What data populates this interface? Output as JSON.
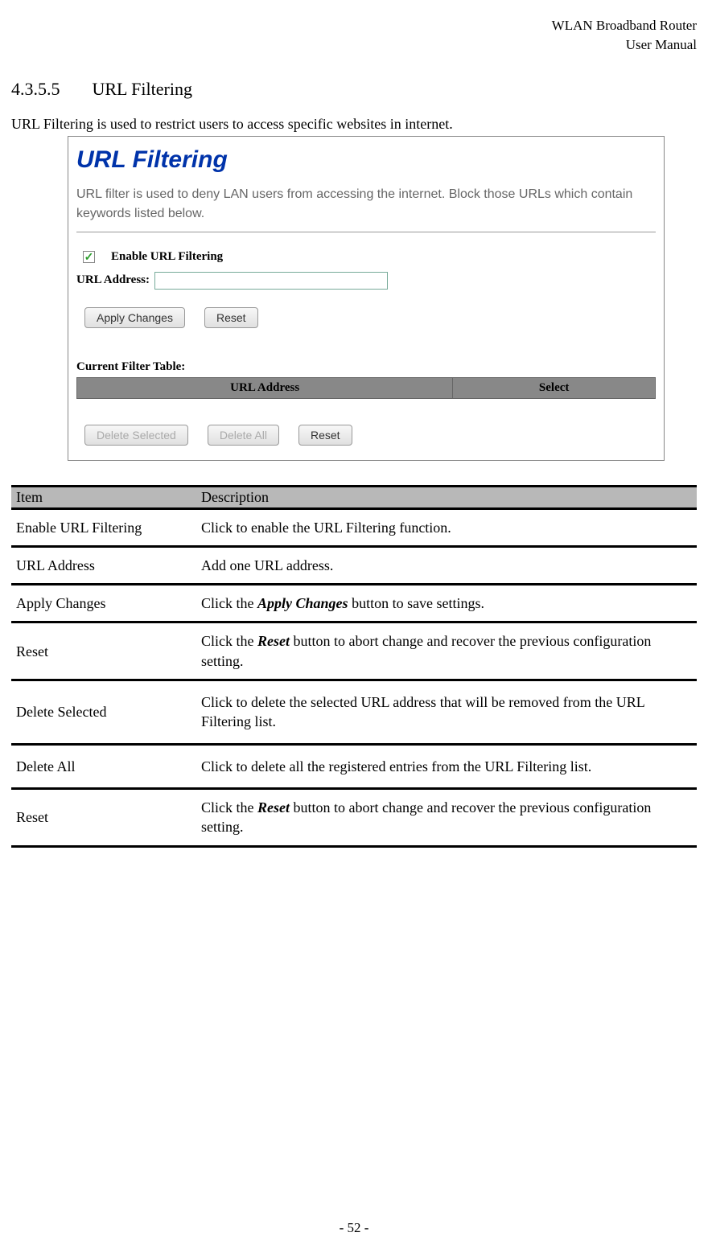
{
  "header": {
    "line1": "WLAN  Broadband  Router",
    "line2": "User  Manual"
  },
  "section": {
    "number": "4.3.5.5",
    "title": "URL Filtering"
  },
  "intro": "URL Filtering is used to restrict users to access specific websites in internet.",
  "screenshot": {
    "title": "URL Filtering",
    "desc": "URL filter is used to deny LAN users from accessing the internet. Block those URLs which contain keywords listed below.",
    "enable_label": "Enable URL Filtering",
    "url_label": "URL Address:",
    "apply_btn": "Apply Changes",
    "reset_btn": "Reset",
    "table_title": "Current Filter Table:",
    "col1": "URL Address",
    "col2": "Select",
    "delete_selected_btn": "Delete Selected",
    "delete_all_btn": "Delete All",
    "reset_btn2": "Reset"
  },
  "table": {
    "header_item": "Item",
    "header_desc": "Description",
    "rows": [
      {
        "item": "Enable URL Filtering",
        "desc": "Click to enable the URL Filtering function."
      },
      {
        "item": "URL Address",
        "desc": "Add one URL address."
      },
      {
        "item": "Apply Changes",
        "desc_pre": "Click the ",
        "desc_em": "Apply Changes",
        "desc_post": " button to save settings."
      },
      {
        "item": "Reset",
        "desc_pre": "Click the ",
        "desc_em": "Reset",
        "desc_post": " button to abort change and recover the previous configuration setting."
      },
      {
        "item": "Delete Selected",
        "desc": "Click to delete the selected URL address that will be removed from the URL Filtering list."
      },
      {
        "item": "Delete All",
        "desc": "Click to delete all the registered entries from the URL Filtering list."
      },
      {
        "item": "Reset",
        "desc_pre": "Click the ",
        "desc_em": "Reset",
        "desc_post": " button to abort change and recover the previous configuration setting."
      }
    ]
  },
  "page_number": "- 52 -"
}
